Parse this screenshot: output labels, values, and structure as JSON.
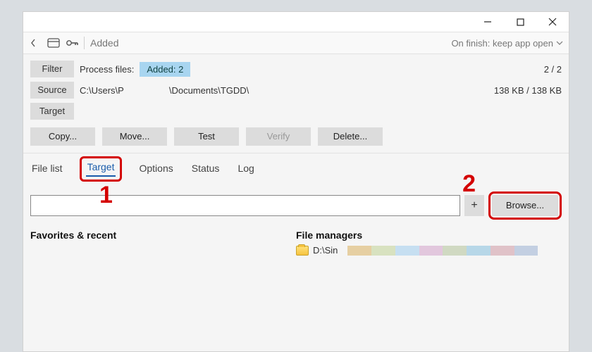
{
  "toolbar": {
    "added_label": "Added",
    "onfinish": "On finish: keep app open"
  },
  "rows": {
    "filter_label": "Filter",
    "process_files_label": "Process files:",
    "added_chip": "Added: 2",
    "count": "2 / 2",
    "source_label": "Source",
    "source_path_left": "C:\\Users\\P",
    "source_path_right": "\\Documents\\TGDD\\",
    "size": "138 KB / 138 KB",
    "target_label": "Target"
  },
  "actions": {
    "copy": "Copy...",
    "move": "Move...",
    "test": "Test",
    "verify": "Verify",
    "delete": "Delete..."
  },
  "tabs": {
    "filelist": "File list",
    "target": "Target",
    "options": "Options",
    "status": "Status",
    "log": "Log"
  },
  "target": {
    "input_value": "",
    "plus": "+",
    "browse": "Browse..."
  },
  "lists": {
    "favorites_head": "Favorites & recent",
    "filemanagers_head": "File managers",
    "fm_item": "D:\\Sin"
  },
  "annotations": {
    "one": "1",
    "two": "2"
  }
}
